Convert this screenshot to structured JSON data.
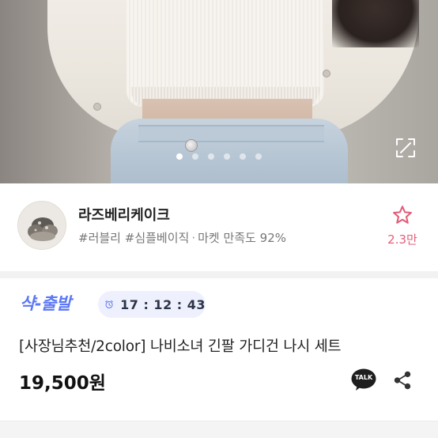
{
  "carousel": {
    "total_slides": 6,
    "active_index": 0,
    "expand_icon": "expand-icon"
  },
  "shop": {
    "name": "라즈베리케이크",
    "tag1": "#러블리",
    "tag2": "#심플베이직",
    "separator": "·",
    "satisfaction": "마켓 만족도 92%",
    "favorites": "2.3만",
    "favorite_icon": "star-outline-icon",
    "accent_color": "#e45e7a"
  },
  "product": {
    "shipping_label": "샥-출발",
    "shipping_color": "#5b77f5",
    "timer": "17 : 12 : 43",
    "timer_icon": "alarm-clock-icon",
    "title": "[사장님추천/2color] 나비소녀 긴팔 가디건 나시 세트",
    "price": "19,500원",
    "talk_label": "TALK",
    "talk_icon": "kakaotalk-icon",
    "share_icon": "share-icon"
  }
}
